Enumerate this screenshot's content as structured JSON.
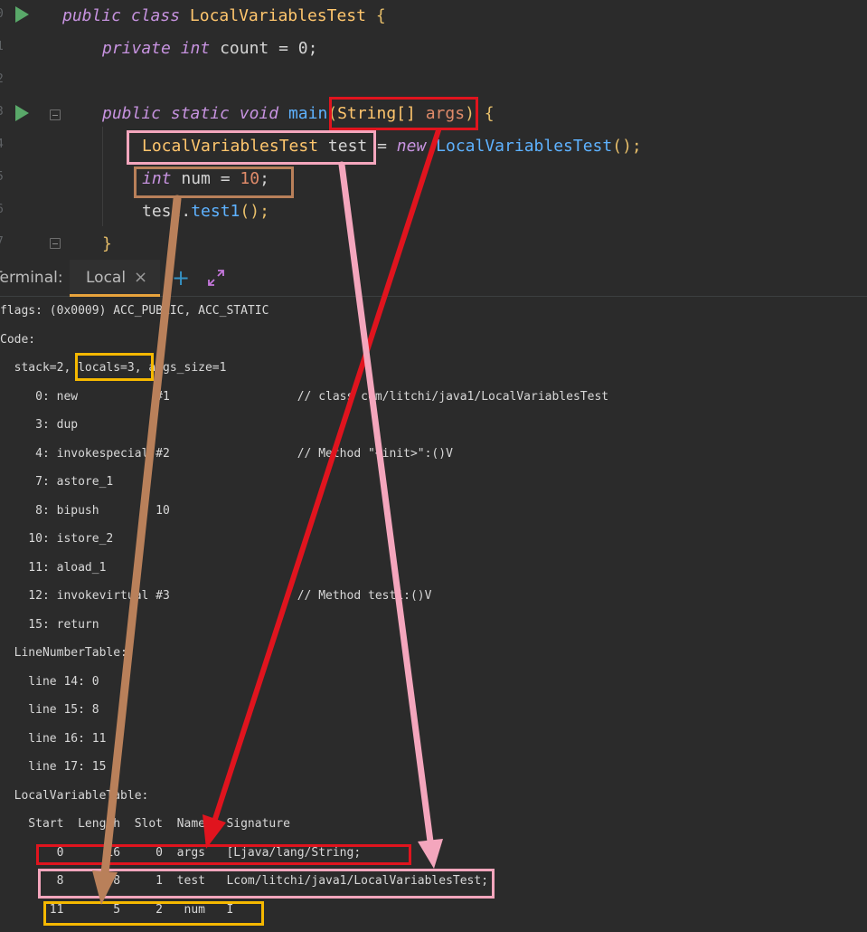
{
  "editor": {
    "gutter": [
      "0",
      "1",
      "2",
      "3",
      "4",
      "5",
      "6",
      "7"
    ],
    "line0": {
      "public": "public",
      "class": "class",
      "name": "LocalVariablesTest",
      "brace": " {"
    },
    "line1": {
      "private": "private",
      "int": "int",
      "field": "count",
      "eq": " = ",
      "val": "0",
      "semi": ";"
    },
    "line3": {
      "public": "public",
      "static": "static",
      "void": "void",
      "main": "main",
      "open": "(",
      "type": "String[]",
      "arg": "args",
      "close": ")",
      "brace": " {"
    },
    "line4": {
      "type": "LocalVariablesTest",
      "var": "test",
      "eq": " = ",
      "new": "new",
      "ctor": "LocalVariablesTest",
      "end": "();"
    },
    "line5": {
      "int": "int",
      "var": "num",
      "eq": " = ",
      "val": "10",
      "semi": ";"
    },
    "line6": {
      "obj": "test",
      "dot": ".",
      "call": "test1",
      "end": "();"
    },
    "line7": {
      "brace": "}"
    }
  },
  "terminal": {
    "label": "Terminal:",
    "tab": "Local",
    "close": "×",
    "add": "+",
    "lines": [
      "flags: (0x0009) ACC_PUBLIC, ACC_STATIC",
      "Code:",
      "  stack=2, locals=3, args_size=1",
      "     0: new           #1                  // class com/litchi/java1/LocalVariablesTest",
      "     3: dup",
      "     4: invokespecial #2                  // Method \"<init>\":()V",
      "     7: astore_1",
      "     8: bipush        10",
      "    10: istore_2",
      "    11: aload_1",
      "    12: invokevirtual #3                  // Method test1:()V",
      "    15: return",
      "  LineNumberTable:",
      "    line 14: 0",
      "    line 15: 8",
      "    line 16: 11",
      "    line 17: 15",
      "  LocalVariableTable:",
      "    Start  Length  Slot  Name   Signature",
      "        0      16     0  args   [Ljava/lang/String;",
      "        8       8     1  test   Lcom/litchi/java1/LocalVariablesTest;",
      "       11       5     2   num   I"
    ]
  },
  "colors": {
    "red": "#e0141e",
    "pink": "#f4a6bd",
    "brown": "#b9805a",
    "yellow": "#f5b800"
  }
}
